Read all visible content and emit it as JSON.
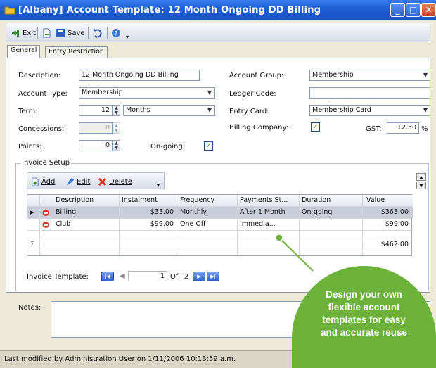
{
  "window": {
    "title": "[Albany] Account Template: 12 Month Ongoing DD Billing",
    "app_icon": "folder-icon",
    "minimize_label": "_",
    "maximize_label": "□",
    "close_label": "✕"
  },
  "toolbar": {
    "exit_label": "Exit",
    "save_label": "Save"
  },
  "tabs": [
    {
      "label": "General",
      "active": true
    },
    {
      "label": "Entry Restriction",
      "active": false
    }
  ],
  "form": {
    "description_label": "Description:",
    "description_value": "12 Month Ongoing DD Billing",
    "account_type_label": "Account Type:",
    "account_type_value": "Membership",
    "term_label": "Term:",
    "term_value": "12",
    "term_unit_value": "Months",
    "concessions_label": "Concessions:",
    "concessions_value": "0",
    "points_label": "Points:",
    "points_value": "0",
    "ongoing_label": "On-going:",
    "ongoing_checked": true,
    "account_group_label": "Account Group:",
    "account_group_value": "Membership",
    "ledger_code_label": "Ledger Code:",
    "ledger_code_value": "",
    "entry_card_label": "Entry Card:",
    "entry_card_value": "Membership Card",
    "billing_company_label": "Billing Company:",
    "billing_company_checked": true,
    "gst_label": "GST:",
    "gst_value": "12.50",
    "gst_unit": "%"
  },
  "invoice_setup": {
    "title": "Invoice Setup",
    "add_label": "Add",
    "edit_label": "Edit",
    "delete_label": "Delete",
    "columns": [
      "Description",
      "Instalment",
      "Frequency",
      "Payments St...",
      "Duration",
      "Value"
    ],
    "rows": [
      {
        "description": "Billing",
        "instalment": "$33.00",
        "frequency": "Monthly",
        "payments_start": "After 1 Month",
        "duration": "On-going",
        "value": "$363.00",
        "selected": true
      },
      {
        "description": "Club",
        "instalment": "$99.00",
        "frequency": "One Off",
        "payments_start": "Immedia...",
        "duration": "",
        "value": "$99.00",
        "selected": false
      }
    ],
    "total_symbol": "Σ",
    "total_value": "$462.00",
    "template_label": "Invoice Template:",
    "page_current": "1",
    "page_of": "Of",
    "page_total": "2"
  },
  "notes_label": "Notes:",
  "status": "Last modified by Administration User on 1/11/2006 10:13:59 a.m.",
  "callout": {
    "lines": [
      "Design your own",
      "flexible account",
      "templates for easy",
      "and accurate reuse"
    ],
    "color": "#6cb23a"
  },
  "colors": {
    "titlebar": "#1f5fd6",
    "selected_row": "#c8cdd9",
    "check": "#21a121",
    "delete_red": "#d33a1e"
  }
}
